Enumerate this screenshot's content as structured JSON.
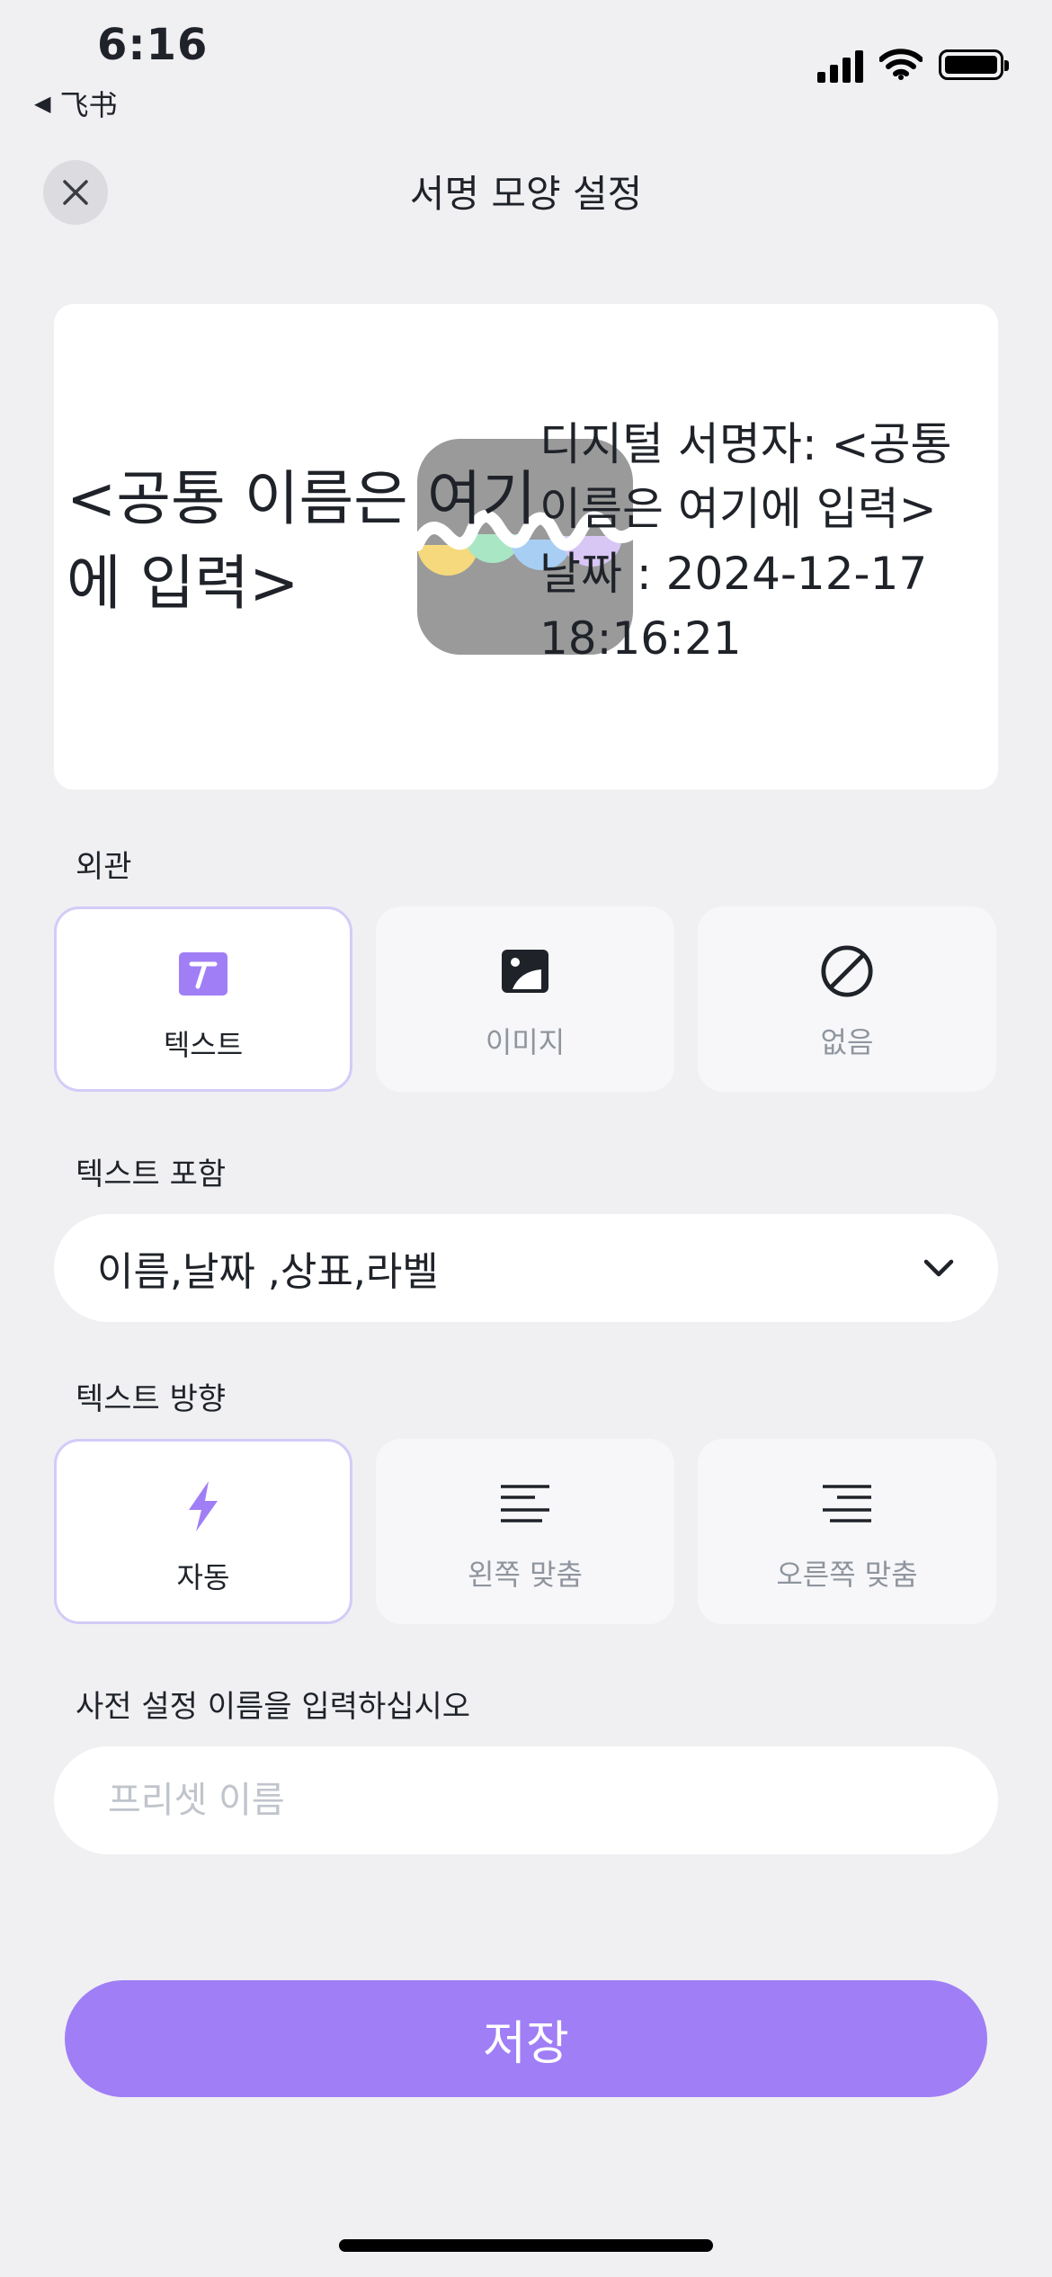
{
  "status_bar": {
    "time": "6:16",
    "back_app": "飞书",
    "icons": [
      "cellular-signal-icon",
      "wifi-icon",
      "battery-icon"
    ]
  },
  "header": {
    "title": "서명 모양 설정",
    "close_icon": "close-icon"
  },
  "preview": {
    "name_text": "<공통 이름은 여기에 입력>",
    "details_line1": "디지털 서명자: <공통 이름은 여기에 입력>",
    "details_line2": "날짜 : 2024-12-17 18:16:21",
    "logo_icon": "app-logo-icon"
  },
  "appearance": {
    "label": "외관",
    "options": [
      {
        "label": "텍스트",
        "icon": "text-icon",
        "selected": true
      },
      {
        "label": "이미지",
        "icon": "image-icon",
        "selected": false
      },
      {
        "label": "없음",
        "icon": "none-icon",
        "selected": false
      }
    ]
  },
  "include_text": {
    "label": "텍스트 포함",
    "value": "이름,날짜 ,상표,라벨",
    "icon": "chevron-down-icon"
  },
  "text_direction": {
    "label": "텍스트 방향",
    "options": [
      {
        "label": "자동",
        "icon": "lightning-icon",
        "selected": true
      },
      {
        "label": "왼쪽 맞춤",
        "icon": "align-left-icon",
        "selected": false
      },
      {
        "label": "오른쪽 맞춤",
        "icon": "align-right-icon",
        "selected": false
      }
    ]
  },
  "preset": {
    "label": "사전 설정 이름을 입력하십시오",
    "placeholder": "프리셋 이름",
    "value": ""
  },
  "save_button": "저장",
  "colors": {
    "accent": "#a07ef6",
    "selected_border": "#d2ccf8",
    "background": "#f0f0f3"
  }
}
